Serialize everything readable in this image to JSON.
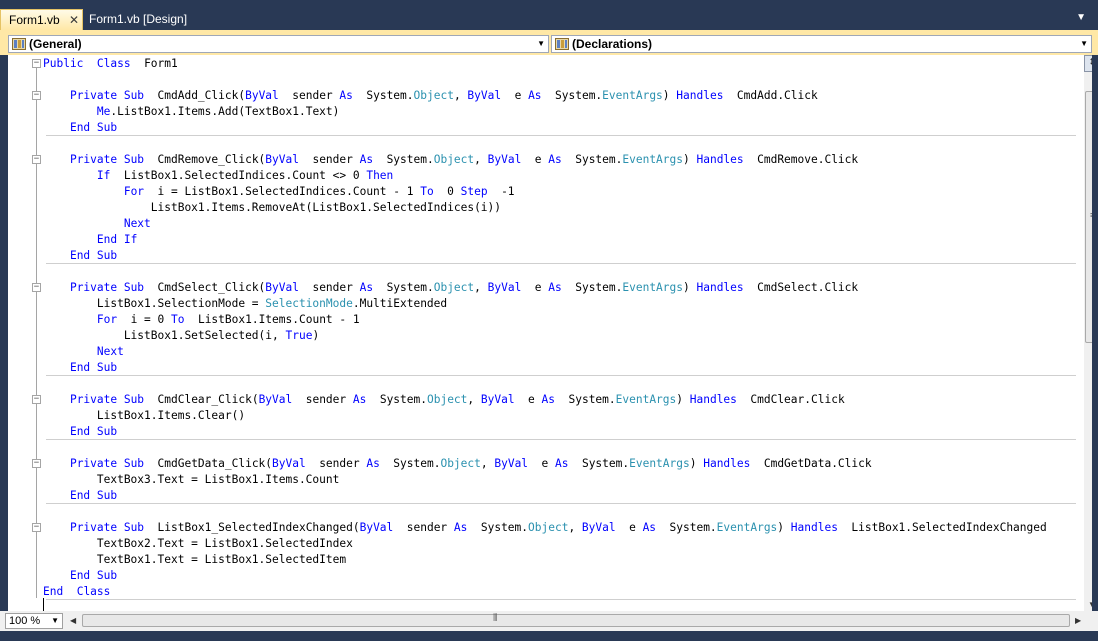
{
  "tabs": [
    {
      "label": "Form1.vb",
      "close": "✕"
    },
    {
      "label": "Form1.vb [Design]"
    }
  ],
  "navbar": {
    "left_combo": "(General)",
    "right_combo": "(Declarations)"
  },
  "status": {
    "zoom": "100 %"
  },
  "colors": {
    "keyword": "#0000ff",
    "type": "#2b91af",
    "active_tab": "#ffe8a6",
    "frame": "#293955"
  },
  "icons": {
    "tab_close": "close-icon",
    "tab_menu": "chevron-down-icon",
    "combo_icon": "class-members-icon",
    "splitter": "splitter-icon"
  },
  "code_lines": [
    [
      [
        "kw",
        "Public"
      ],
      [
        "",
        "  "
      ],
      [
        "kw",
        "Class"
      ],
      [
        "",
        "  Form1"
      ]
    ],
    [],
    [
      [
        "",
        "    "
      ],
      [
        "kw",
        "Private Sub"
      ],
      [
        "",
        "  CmdAdd_Click("
      ],
      [
        "kw",
        "ByVal"
      ],
      [
        "",
        "  sender "
      ],
      [
        "kw",
        "As"
      ],
      [
        "",
        "  System."
      ],
      [
        "ty",
        "Object"
      ],
      [
        "",
        ", "
      ],
      [
        "kw",
        "ByVal"
      ],
      [
        "",
        "  e "
      ],
      [
        "kw",
        "As"
      ],
      [
        "",
        "  System."
      ],
      [
        "ty",
        "EventArgs"
      ],
      [
        "",
        ") "
      ],
      [
        "kw",
        "Handles"
      ],
      [
        "",
        "  CmdAdd.Click"
      ]
    ],
    [
      [
        "",
        "        "
      ],
      [
        "kw",
        "Me"
      ],
      [
        "",
        ".ListBox1.Items.Add(TextBox1.Text)"
      ]
    ],
    [
      [
        "",
        "    "
      ],
      [
        "kw",
        "End Sub"
      ]
    ],
    [],
    [
      [
        "",
        "    "
      ],
      [
        "kw",
        "Private Sub"
      ],
      [
        "",
        "  CmdRemove_Click("
      ],
      [
        "kw",
        "ByVal"
      ],
      [
        "",
        "  sender "
      ],
      [
        "kw",
        "As"
      ],
      [
        "",
        "  System."
      ],
      [
        "ty",
        "Object"
      ],
      [
        "",
        ", "
      ],
      [
        "kw",
        "ByVal"
      ],
      [
        "",
        "  e "
      ],
      [
        "kw",
        "As"
      ],
      [
        "",
        "  System."
      ],
      [
        "ty",
        "EventArgs"
      ],
      [
        "",
        ") "
      ],
      [
        "kw",
        "Handles"
      ],
      [
        "",
        "  CmdRemove.Click"
      ]
    ],
    [
      [
        "",
        "        "
      ],
      [
        "kw",
        "If"
      ],
      [
        "",
        "  ListBox1.SelectedIndices.Count <> 0 "
      ],
      [
        "kw",
        "Then"
      ]
    ],
    [
      [
        "",
        "            "
      ],
      [
        "kw",
        "For"
      ],
      [
        "",
        "  i = ListBox1.SelectedIndices.Count - 1 "
      ],
      [
        "kw",
        "To"
      ],
      [
        "",
        "  0 "
      ],
      [
        "kw",
        "Step"
      ],
      [
        "",
        "  -1"
      ]
    ],
    [
      [
        "",
        "                ListBox1.Items.RemoveAt(ListBox1.SelectedIndices(i))"
      ]
    ],
    [
      [
        "",
        "            "
      ],
      [
        "kw",
        "Next"
      ]
    ],
    [
      [
        "",
        "        "
      ],
      [
        "kw",
        "End If"
      ]
    ],
    [
      [
        "",
        "    "
      ],
      [
        "kw",
        "End Sub"
      ]
    ],
    [],
    [
      [
        "",
        "    "
      ],
      [
        "kw",
        "Private Sub"
      ],
      [
        "",
        "  CmdSelect_Click("
      ],
      [
        "kw",
        "ByVal"
      ],
      [
        "",
        "  sender "
      ],
      [
        "kw",
        "As"
      ],
      [
        "",
        "  System."
      ],
      [
        "ty",
        "Object"
      ],
      [
        "",
        ", "
      ],
      [
        "kw",
        "ByVal"
      ],
      [
        "",
        "  e "
      ],
      [
        "kw",
        "As"
      ],
      [
        "",
        "  System."
      ],
      [
        "ty",
        "EventArgs"
      ],
      [
        "",
        ") "
      ],
      [
        "kw",
        "Handles"
      ],
      [
        "",
        "  CmdSelect.Click"
      ]
    ],
    [
      [
        "",
        "        ListBox1.SelectionMode = "
      ],
      [
        "ty",
        "SelectionMode"
      ],
      [
        "",
        ".MultiExtended"
      ]
    ],
    [
      [
        "",
        "        "
      ],
      [
        "kw",
        "For"
      ],
      [
        "",
        "  i = 0 "
      ],
      [
        "kw",
        "To"
      ],
      [
        "",
        "  ListBox1.Items.Count - 1"
      ]
    ],
    [
      [
        "",
        "            ListBox1.SetSelected(i, "
      ],
      [
        "kw",
        "True"
      ],
      [
        "",
        ")"
      ]
    ],
    [
      [
        "",
        "        "
      ],
      [
        "kw",
        "Next"
      ]
    ],
    [
      [
        "",
        "    "
      ],
      [
        "kw",
        "End Sub"
      ]
    ],
    [],
    [
      [
        "",
        "    "
      ],
      [
        "kw",
        "Private Sub"
      ],
      [
        "",
        "  CmdClear_Click("
      ],
      [
        "kw",
        "ByVal"
      ],
      [
        "",
        "  sender "
      ],
      [
        "kw",
        "As"
      ],
      [
        "",
        "  System."
      ],
      [
        "ty",
        "Object"
      ],
      [
        "",
        ", "
      ],
      [
        "kw",
        "ByVal"
      ],
      [
        "",
        "  e "
      ],
      [
        "kw",
        "As"
      ],
      [
        "",
        "  System."
      ],
      [
        "ty",
        "EventArgs"
      ],
      [
        "",
        ") "
      ],
      [
        "kw",
        "Handles"
      ],
      [
        "",
        "  CmdClear.Click"
      ]
    ],
    [
      [
        "",
        "        ListBox1.Items.Clear()"
      ]
    ],
    [
      [
        "",
        "    "
      ],
      [
        "kw",
        "End Sub"
      ]
    ],
    [],
    [
      [
        "",
        "    "
      ],
      [
        "kw",
        "Private Sub"
      ],
      [
        "",
        "  CmdGetData_Click("
      ],
      [
        "kw",
        "ByVal"
      ],
      [
        "",
        "  sender "
      ],
      [
        "kw",
        "As"
      ],
      [
        "",
        "  System."
      ],
      [
        "ty",
        "Object"
      ],
      [
        "",
        ", "
      ],
      [
        "kw",
        "ByVal"
      ],
      [
        "",
        "  e "
      ],
      [
        "kw",
        "As"
      ],
      [
        "",
        "  System."
      ],
      [
        "ty",
        "EventArgs"
      ],
      [
        "",
        ") "
      ],
      [
        "kw",
        "Handles"
      ],
      [
        "",
        "  CmdGetData.Click"
      ]
    ],
    [
      [
        "",
        "        TextBox3.Text = ListBox1.Items.Count"
      ]
    ],
    [
      [
        "",
        "    "
      ],
      [
        "kw",
        "End Sub"
      ]
    ],
    [],
    [
      [
        "",
        "    "
      ],
      [
        "kw",
        "Private Sub"
      ],
      [
        "",
        "  ListBox1_SelectedIndexChanged("
      ],
      [
        "kw",
        "ByVal"
      ],
      [
        "",
        "  sender "
      ],
      [
        "kw",
        "As"
      ],
      [
        "",
        "  System."
      ],
      [
        "ty",
        "Object"
      ],
      [
        "",
        ", "
      ],
      [
        "kw",
        "ByVal"
      ],
      [
        "",
        "  e "
      ],
      [
        "kw",
        "As"
      ],
      [
        "",
        "  System."
      ],
      [
        "ty",
        "EventArgs"
      ],
      [
        "",
        ") "
      ],
      [
        "kw",
        "Handles"
      ],
      [
        "",
        "  ListBox1.SelectedIndexChanged"
      ]
    ],
    [
      [
        "",
        "        TextBox2.Text = ListBox1.SelectedIndex"
      ]
    ],
    [
      [
        "",
        "        TextBox1.Text = ListBox1.SelectedItem"
      ]
    ],
    [
      [
        "",
        "    "
      ],
      [
        "kw",
        "End Sub"
      ]
    ],
    [
      [
        "kw",
        "End"
      ],
      [
        "",
        "  "
      ],
      [
        "kw",
        "Class"
      ]
    ],
    []
  ]
}
